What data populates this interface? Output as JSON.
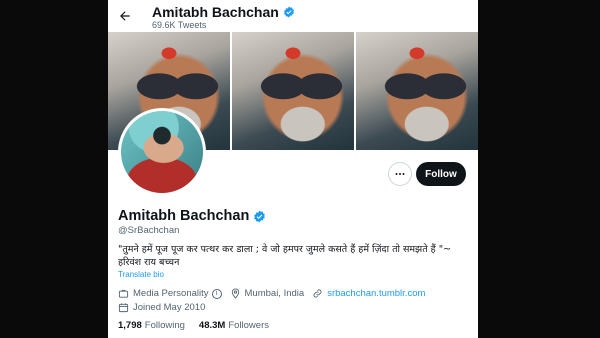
{
  "header": {
    "name": "Amitabh Bachchan",
    "tweet_count": "69.6K Tweets"
  },
  "profile": {
    "name": "Amitabh Bachchan",
    "handle": "@SrBachchan",
    "bio": "\"तुमने हमें पूज पूज कर पत्थर कर डाला ; वे जो हमपर जुमले कसते हैं हमें ज़िंदा तो समझते हैं \"~ हरिवंश राय बच्चन",
    "translate_label": "Translate bio",
    "category": "Media Personality",
    "location": "Mumbai, India",
    "website": "srbachchan.tumblr.com",
    "joined": "Joined May 2010",
    "following_count": "1,798",
    "following_label": "Following",
    "followers_count": "48.3M",
    "followers_label": "Followers"
  },
  "actions": {
    "follow_label": "Follow"
  },
  "colors": {
    "accent": "#1d9bf0",
    "text": "#0f1419",
    "muted": "#536471",
    "verified": "#1d9bf0"
  },
  "icons": {
    "back": "arrow-left-icon",
    "verified": "verified-badge-icon",
    "more": "more-icon",
    "category": "briefcase-icon",
    "location": "location-pin-icon",
    "website": "link-icon",
    "joined": "calendar-icon",
    "info": "info-icon"
  }
}
